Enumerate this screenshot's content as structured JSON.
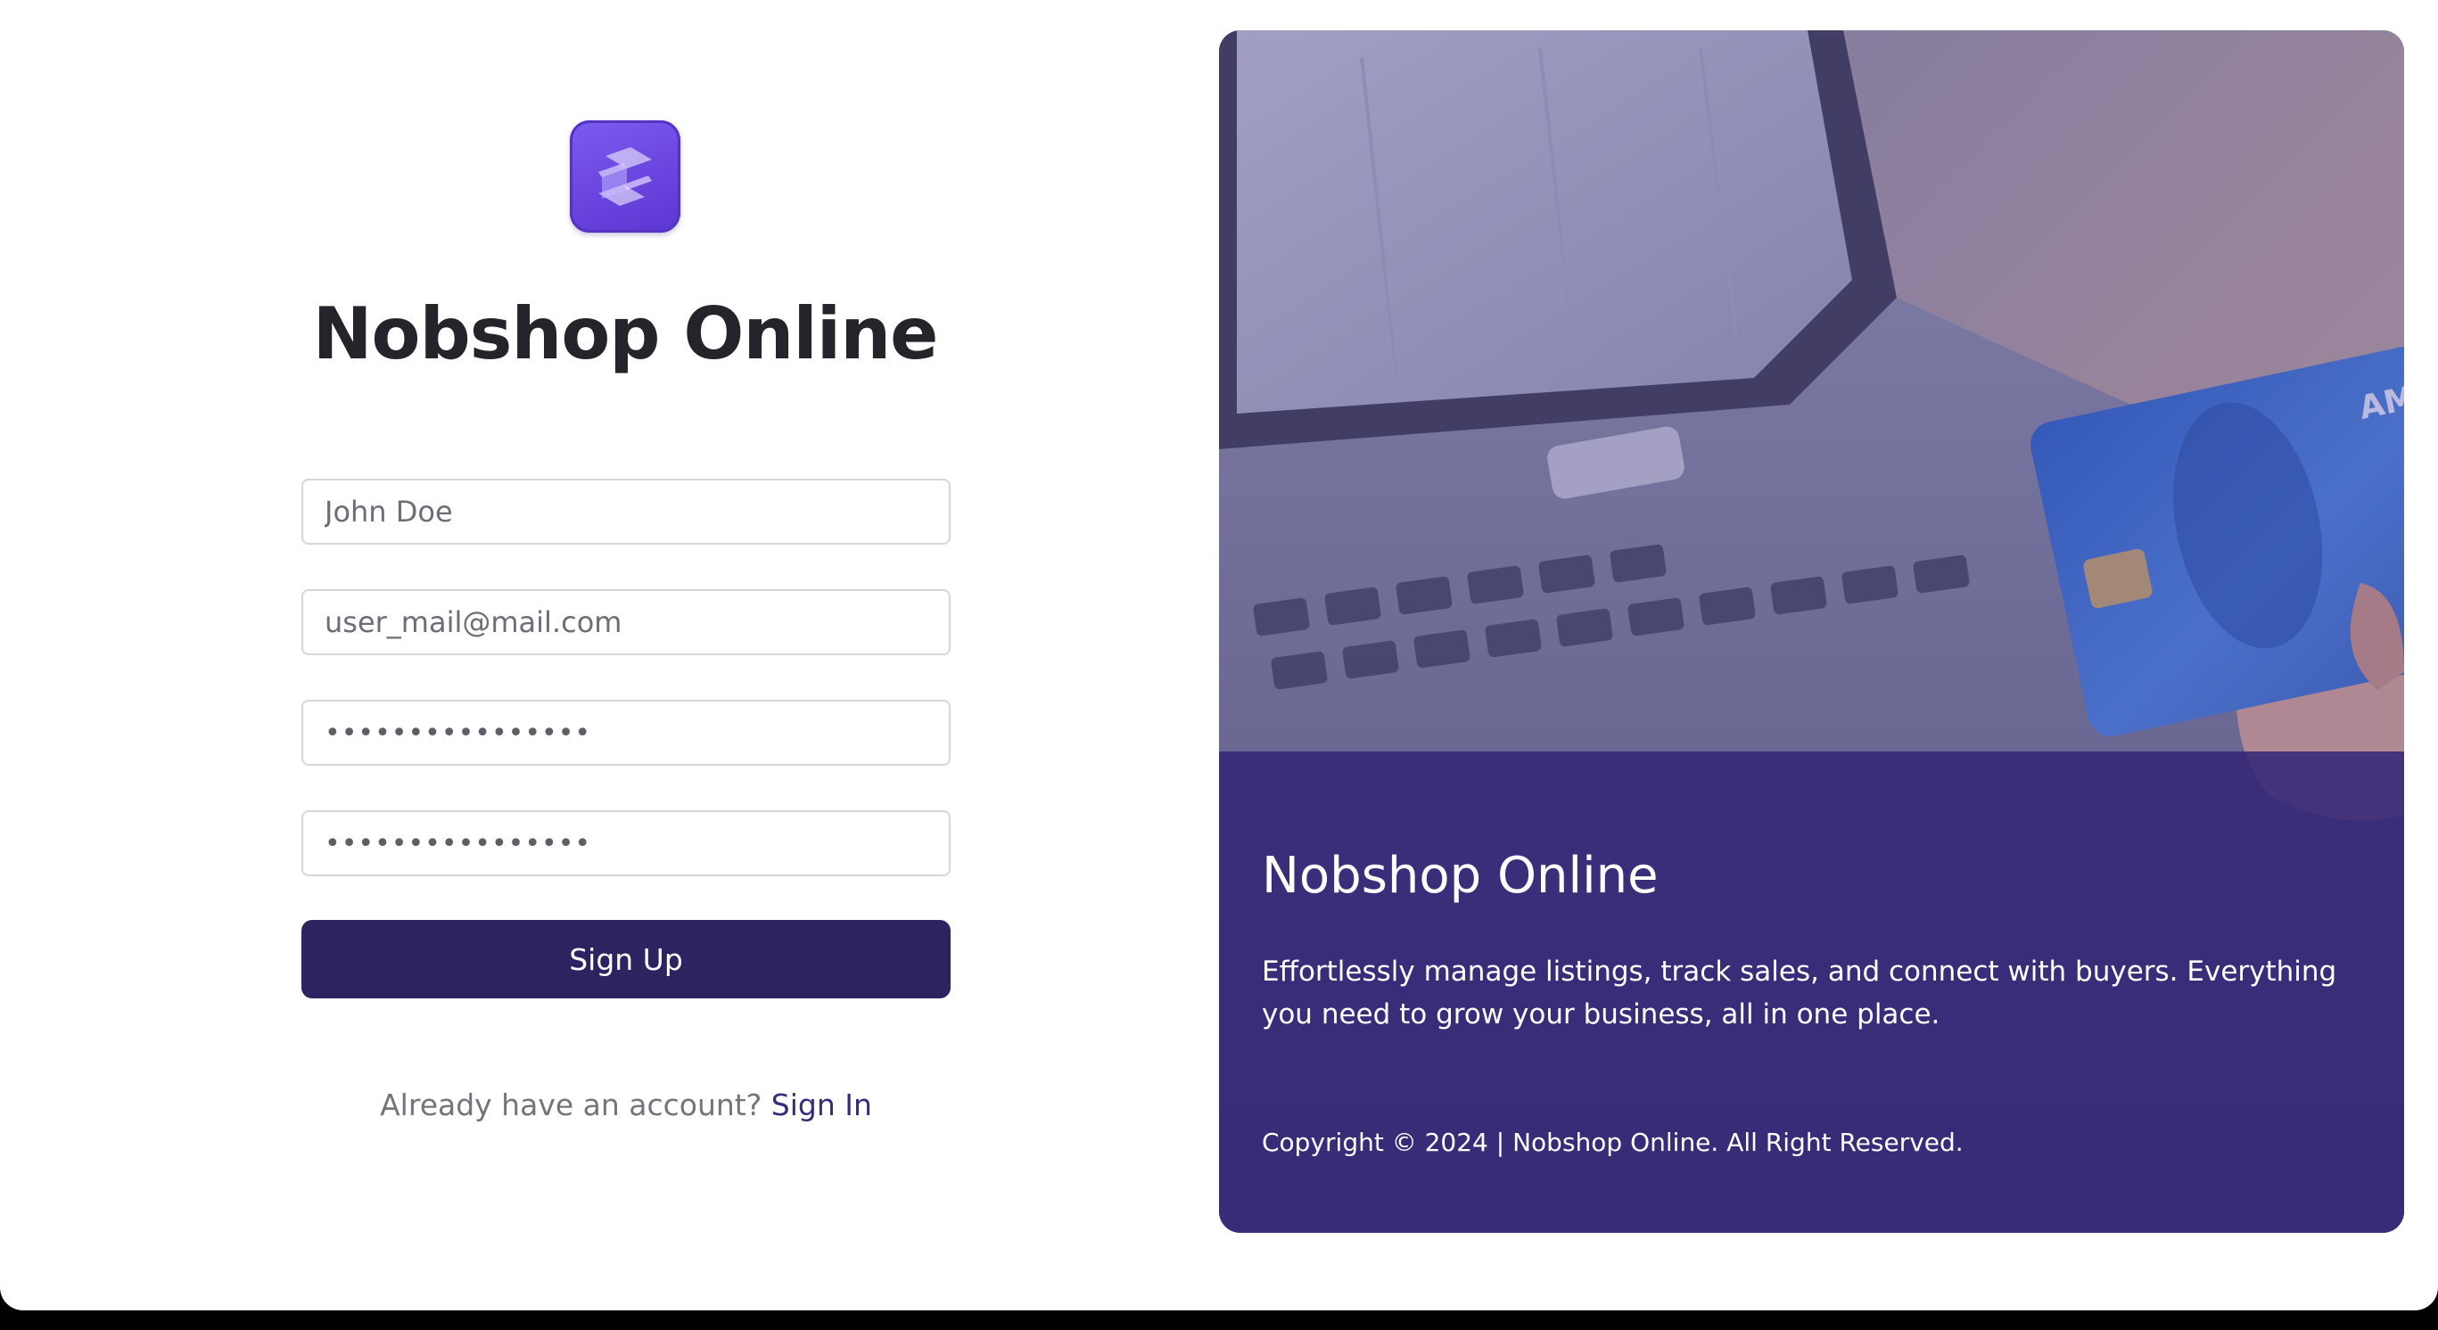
{
  "brand": {
    "name": "Nobshop Online",
    "accent_color": "#6a45df",
    "button_color": "#2e2260"
  },
  "signup_form": {
    "name_field": {
      "value": "",
      "placeholder": "John Doe"
    },
    "email_field": {
      "value": "",
      "placeholder": "user_mail@mail.com"
    },
    "password_field": {
      "value": "••••••••••••••••"
    },
    "confirm_password_field": {
      "value": "••••••••••••••••"
    },
    "submit_label": "Sign Up",
    "signin_prompt": "Already have an account?",
    "signin_link": "Sign In"
  },
  "hero": {
    "image": "laptop-credit-card-photo",
    "card_text": "AMERICAN EXPRESS",
    "title": "Nobshop Online",
    "description": "Effortlessly manage listings, track sales, and connect with buyers. Everything you need to grow your business, all in one place.",
    "copyright": "Copyright © 2024 | Nobshop Online. All Right Reserved."
  }
}
